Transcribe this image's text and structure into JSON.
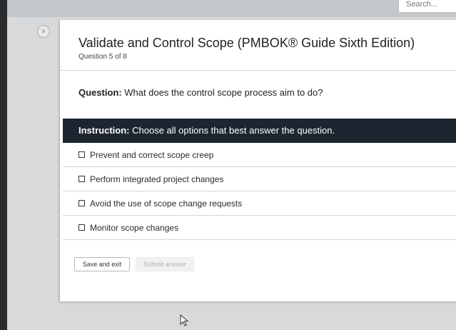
{
  "search": {
    "placeholder": "Search..."
  },
  "quiz": {
    "title": "Validate and Control Scope (PMBOK® Guide Sixth Edition)",
    "progress": "Question 5 of 8",
    "question_label": "Question:",
    "question_text": " What does the control scope process aim to do?",
    "instruction_label": "Instruction:",
    "instruction_text": " Choose all options that best answer the question.",
    "options": [
      "Prevent and correct scope creep",
      "Perform integrated project changes",
      "Avoid the use of scope change requests",
      "Monitor scope changes"
    ],
    "save_label": "Save and exit",
    "submit_label": "Submit answer"
  },
  "icons": {
    "sidebar_toggle": "chevron-right-icon",
    "cursor": "mouse-pointer-icon"
  },
  "colors": {
    "instruction_bar": "#1c2530",
    "card_bg": "#ffffff",
    "disabled_text": "#b3b3b3"
  }
}
